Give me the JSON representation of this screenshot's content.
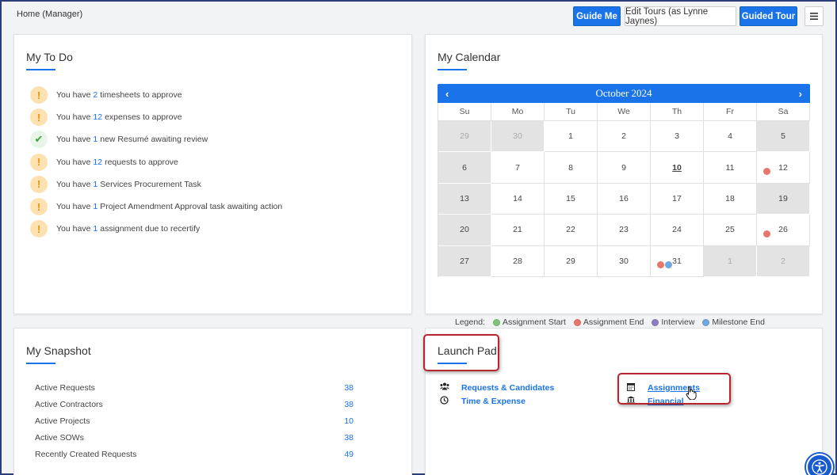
{
  "breadcrumb": "Home (Manager)",
  "toolbar": {
    "guide_me": "Guide Me",
    "edit_tours": "Edit Tours (as Lynne Jaynes)",
    "guided_tour": "Guided Tour",
    "menu_icon": "hamburger-icon"
  },
  "todo": {
    "title": "My To Do",
    "items": [
      {
        "icon": "warning",
        "pre": "You have",
        "num": "2",
        "post": "timesheets to approve"
      },
      {
        "icon": "warning",
        "pre": "You have",
        "num": "12",
        "post": "expenses to approve"
      },
      {
        "icon": "check",
        "pre": "You have",
        "num": "1",
        "post": "new Resumé awaiting review"
      },
      {
        "icon": "warning",
        "pre": "You have",
        "num": "12",
        "post": "requests to approve"
      },
      {
        "icon": "warning",
        "pre": "You have",
        "num": "1",
        "post": "Services Procurement Task"
      },
      {
        "icon": "warning",
        "pre": "You have",
        "num": "1",
        "post": "Project Amendment Approval task awaiting action"
      },
      {
        "icon": "warning",
        "pre": "You have",
        "num": "1",
        "post": "assignment due to recertify"
      }
    ]
  },
  "calendar": {
    "title": "My Calendar",
    "month": "October 2024",
    "prev": "‹",
    "next": "›",
    "dow": [
      "Su",
      "Mo",
      "Tu",
      "We",
      "Th",
      "Fr",
      "Sa"
    ],
    "weeks": [
      [
        "29",
        "30",
        "1",
        "2",
        "3",
        "4",
        "5"
      ],
      [
        "6",
        "7",
        "8",
        "9",
        "10",
        "11",
        "12"
      ],
      [
        "13",
        "14",
        "15",
        "16",
        "17",
        "18",
        "19"
      ],
      [
        "20",
        "21",
        "22",
        "23",
        "24",
        "25",
        "26"
      ],
      [
        "27",
        "28",
        "29",
        "30",
        "31",
        "1",
        "2"
      ]
    ],
    "today": "10",
    "legend_label": "Legend:",
    "legend": [
      {
        "label": "Assignment Start",
        "color": "#7cc576"
      },
      {
        "label": "Assignment End",
        "color": "#e8766a"
      },
      {
        "label": "Interview",
        "color": "#8e7cc3"
      },
      {
        "label": "Milestone End",
        "color": "#6fa8dc"
      }
    ],
    "colors": {
      "assignment_end": "#e8766a",
      "milestone_end": "#6fa8dc"
    }
  },
  "snapshot": {
    "title": "My Snapshot",
    "rows": [
      {
        "label": "Active Requests",
        "value": "38"
      },
      {
        "label": "Active Contractors",
        "value": "38"
      },
      {
        "label": "Active Projects",
        "value": "10"
      },
      {
        "label": "Active SOWs",
        "value": "38"
      },
      {
        "label": "Recently Created Requests",
        "value": "49"
      }
    ]
  },
  "launchpad": {
    "title": "Launch Pad",
    "links": {
      "requests": {
        "label": "Requests & Candidates",
        "icon": "users-icon"
      },
      "time": {
        "label": "Time & Expense",
        "icon": "clock-icon"
      },
      "assignments": {
        "label": "Assignments",
        "icon": "calendar-icon"
      },
      "financial": {
        "label": "Financial",
        "icon": "bank-icon"
      }
    }
  },
  "colors": {
    "accent": "#1a73e8",
    "highlight": "#b8252f"
  }
}
